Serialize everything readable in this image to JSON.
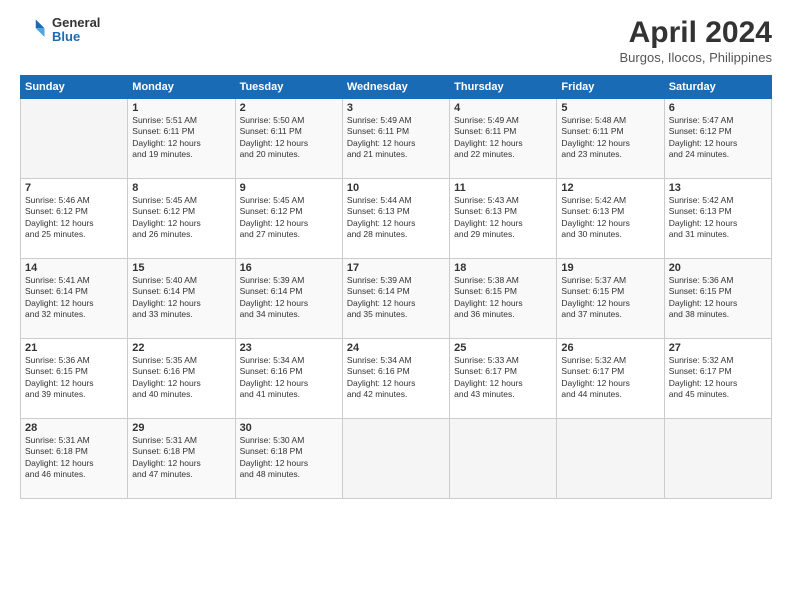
{
  "logo": {
    "general": "General",
    "blue": "Blue"
  },
  "title": "April 2024",
  "subtitle": "Burgos, Ilocos, Philippines",
  "days_header": [
    "Sunday",
    "Monday",
    "Tuesday",
    "Wednesday",
    "Thursday",
    "Friday",
    "Saturday"
  ],
  "weeks": [
    [
      {
        "num": "",
        "info": ""
      },
      {
        "num": "1",
        "info": "Sunrise: 5:51 AM\nSunset: 6:11 PM\nDaylight: 12 hours\nand 19 minutes."
      },
      {
        "num": "2",
        "info": "Sunrise: 5:50 AM\nSunset: 6:11 PM\nDaylight: 12 hours\nand 20 minutes."
      },
      {
        "num": "3",
        "info": "Sunrise: 5:49 AM\nSunset: 6:11 PM\nDaylight: 12 hours\nand 21 minutes."
      },
      {
        "num": "4",
        "info": "Sunrise: 5:49 AM\nSunset: 6:11 PM\nDaylight: 12 hours\nand 22 minutes."
      },
      {
        "num": "5",
        "info": "Sunrise: 5:48 AM\nSunset: 6:11 PM\nDaylight: 12 hours\nand 23 minutes."
      },
      {
        "num": "6",
        "info": "Sunrise: 5:47 AM\nSunset: 6:12 PM\nDaylight: 12 hours\nand 24 minutes."
      }
    ],
    [
      {
        "num": "7",
        "info": "Sunrise: 5:46 AM\nSunset: 6:12 PM\nDaylight: 12 hours\nand 25 minutes."
      },
      {
        "num": "8",
        "info": "Sunrise: 5:45 AM\nSunset: 6:12 PM\nDaylight: 12 hours\nand 26 minutes."
      },
      {
        "num": "9",
        "info": "Sunrise: 5:45 AM\nSunset: 6:12 PM\nDaylight: 12 hours\nand 27 minutes."
      },
      {
        "num": "10",
        "info": "Sunrise: 5:44 AM\nSunset: 6:13 PM\nDaylight: 12 hours\nand 28 minutes."
      },
      {
        "num": "11",
        "info": "Sunrise: 5:43 AM\nSunset: 6:13 PM\nDaylight: 12 hours\nand 29 minutes."
      },
      {
        "num": "12",
        "info": "Sunrise: 5:42 AM\nSunset: 6:13 PM\nDaylight: 12 hours\nand 30 minutes."
      },
      {
        "num": "13",
        "info": "Sunrise: 5:42 AM\nSunset: 6:13 PM\nDaylight: 12 hours\nand 31 minutes."
      }
    ],
    [
      {
        "num": "14",
        "info": "Sunrise: 5:41 AM\nSunset: 6:14 PM\nDaylight: 12 hours\nand 32 minutes."
      },
      {
        "num": "15",
        "info": "Sunrise: 5:40 AM\nSunset: 6:14 PM\nDaylight: 12 hours\nand 33 minutes."
      },
      {
        "num": "16",
        "info": "Sunrise: 5:39 AM\nSunset: 6:14 PM\nDaylight: 12 hours\nand 34 minutes."
      },
      {
        "num": "17",
        "info": "Sunrise: 5:39 AM\nSunset: 6:14 PM\nDaylight: 12 hours\nand 35 minutes."
      },
      {
        "num": "18",
        "info": "Sunrise: 5:38 AM\nSunset: 6:15 PM\nDaylight: 12 hours\nand 36 minutes."
      },
      {
        "num": "19",
        "info": "Sunrise: 5:37 AM\nSunset: 6:15 PM\nDaylight: 12 hours\nand 37 minutes."
      },
      {
        "num": "20",
        "info": "Sunrise: 5:36 AM\nSunset: 6:15 PM\nDaylight: 12 hours\nand 38 minutes."
      }
    ],
    [
      {
        "num": "21",
        "info": "Sunrise: 5:36 AM\nSunset: 6:15 PM\nDaylight: 12 hours\nand 39 minutes."
      },
      {
        "num": "22",
        "info": "Sunrise: 5:35 AM\nSunset: 6:16 PM\nDaylight: 12 hours\nand 40 minutes."
      },
      {
        "num": "23",
        "info": "Sunrise: 5:34 AM\nSunset: 6:16 PM\nDaylight: 12 hours\nand 41 minutes."
      },
      {
        "num": "24",
        "info": "Sunrise: 5:34 AM\nSunset: 6:16 PM\nDaylight: 12 hours\nand 42 minutes."
      },
      {
        "num": "25",
        "info": "Sunrise: 5:33 AM\nSunset: 6:17 PM\nDaylight: 12 hours\nand 43 minutes."
      },
      {
        "num": "26",
        "info": "Sunrise: 5:32 AM\nSunset: 6:17 PM\nDaylight: 12 hours\nand 44 minutes."
      },
      {
        "num": "27",
        "info": "Sunrise: 5:32 AM\nSunset: 6:17 PM\nDaylight: 12 hours\nand 45 minutes."
      }
    ],
    [
      {
        "num": "28",
        "info": "Sunrise: 5:31 AM\nSunset: 6:18 PM\nDaylight: 12 hours\nand 46 minutes."
      },
      {
        "num": "29",
        "info": "Sunrise: 5:31 AM\nSunset: 6:18 PM\nDaylight: 12 hours\nand 47 minutes."
      },
      {
        "num": "30",
        "info": "Sunrise: 5:30 AM\nSunset: 6:18 PM\nDaylight: 12 hours\nand 48 minutes."
      },
      {
        "num": "",
        "info": ""
      },
      {
        "num": "",
        "info": ""
      },
      {
        "num": "",
        "info": ""
      },
      {
        "num": "",
        "info": ""
      }
    ]
  ]
}
